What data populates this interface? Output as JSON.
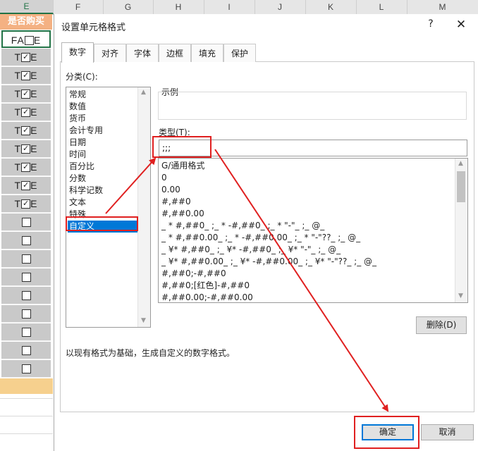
{
  "spreadsheet": {
    "columns": [
      "E",
      "F",
      "G",
      "H",
      "I",
      "J",
      "K",
      "L",
      "M"
    ],
    "header_cell": "是否购买",
    "selected_cell_text": "FALSE",
    "checked_cell_text": "TRUE",
    "checked_count": 9,
    "unchecked_count": 9,
    "header_color": "#f4b183"
  },
  "dialog": {
    "title": "设置单元格格式",
    "help_label": "?",
    "close_label": "✕",
    "tabs": [
      "数字",
      "对齐",
      "字体",
      "边框",
      "填充",
      "保护"
    ],
    "active_tab": "数字",
    "category_label": "分类(C):",
    "categories": [
      "常规",
      "数值",
      "货币",
      "会计专用",
      "日期",
      "时间",
      "百分比",
      "分数",
      "科学记数",
      "文本",
      "特殊",
      "自定义"
    ],
    "selected_category": "自定义",
    "example_label": "示例",
    "type_label": "类型(T):",
    "type_value": ";;;",
    "formats": [
      "G/通用格式",
      "0",
      "0.00",
      "#,##0",
      "#,##0.00",
      "_ * #,##0_ ;_ * -#,##0_ ;_ * \"-\"_ ;_ @_",
      "_ * #,##0.00_ ;_ * -#,##0.00_ ;_ * \"-\"??_ ;_ @_",
      "_ ¥* #,##0_ ;_ ¥* -#,##0_ ;_ ¥* \"-\"_ ;_ @_",
      "_ ¥* #,##0.00_ ;_ ¥* -#,##0.00_ ;_ ¥* \"-\"??_ ;_ @_",
      "#,##0;-#,##0",
      "#,##0;[红色]-#,##0",
      "#,##0.00;-#,##0.00"
    ],
    "delete_label": "删除(D)",
    "description": "以现有格式为基础，生成自定义的数字格式。",
    "ok_label": "确定",
    "cancel_label": "取消"
  },
  "colors": {
    "accent": "#0078d7",
    "annotation": "#e02020",
    "excel_green": "#217346"
  }
}
